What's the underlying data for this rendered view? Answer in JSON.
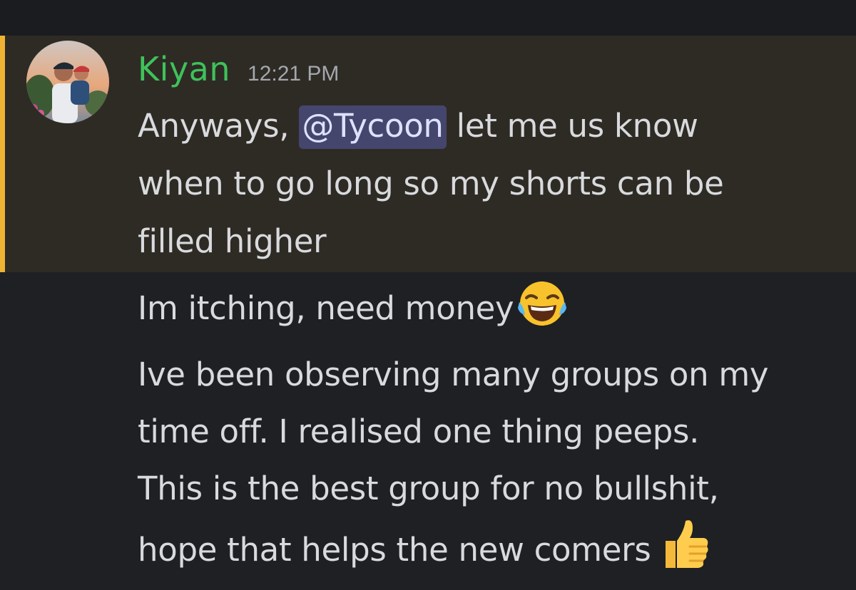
{
  "message": {
    "author": "Kiyan",
    "timestamp": "12:21 PM",
    "avatar_icon": "user-avatar-photo",
    "highlight_color": "#f0b232",
    "username_color": "#3fc25a",
    "lines": {
      "line1_before": "Anyways, ",
      "mention": "@Tycoon",
      "line1_after": " let me us know",
      "line2": "when to go long so my shorts can be",
      "line3": "filled higher"
    }
  },
  "followups": {
    "msg2": "Im itching, need money",
    "msg2_emoji": "face-with-tears-of-joy-icon",
    "msg3_line1": "Ive been observing many groups on my",
    "msg3_line2": "time off. I realised one thing peeps.",
    "msg3_line3": "This is the best group for no bullshit,",
    "msg3_line4": "hope that helps the new comers",
    "msg3_emoji": "thumbs-up-icon"
  }
}
